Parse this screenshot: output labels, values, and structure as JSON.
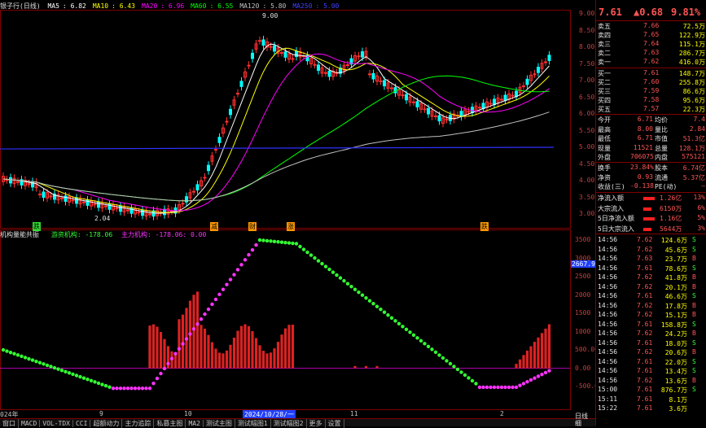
{
  "main": {
    "title": "银子行(日线)",
    "ma": [
      {
        "label": "MA5",
        "value": "6.82",
        "color": "#ffffff"
      },
      {
        "label": "MA10",
        "value": "6.43",
        "color": "#ffff00"
      },
      {
        "label": "MA20",
        "value": "6.96",
        "color": "#ff00ff"
      },
      {
        "label": "MA60",
        "value": "6.55",
        "color": "#00ff00"
      },
      {
        "label": "MA120",
        "value": "5.80",
        "color": "#c0c0c0"
      },
      {
        "label": "MA250",
        "value": "5.00",
        "color": "#4040ff"
      }
    ],
    "y_ticks": [
      "9.00",
      "8.50",
      "8.00",
      "7.50",
      "7.00",
      "6.50",
      "6.00",
      "5.50",
      "5.00",
      "4.50",
      "4.00",
      "3.50",
      "3.00"
    ],
    "high_label": "9.00",
    "low_label": "2.04",
    "markers": [
      "跌",
      "减",
      "财",
      "涨",
      "跌"
    ]
  },
  "sub": {
    "title": "机构量能共振",
    "item1": "游资机构: -178.06",
    "item2": "主力机构: -178.06: 0.00",
    "y_ticks": [
      "3500",
      "3000",
      "2500",
      "2000",
      "1500",
      "1000",
      "500.00",
      "0.00",
      "-500.00"
    ],
    "current_tag": "2667.95"
  },
  "dates": {
    "d1": "024年",
    "d2": "9",
    "d3": "10",
    "d4": "2024/10/28/一",
    "d5": "11",
    "d6": "12",
    "d7": "2"
  },
  "tabs": [
    "窗口",
    "MACD",
    "VOL-TDX",
    "CCI",
    "超额动力",
    "主力追踪",
    "私募主图",
    "MA2",
    "测试主图",
    "测试幅图1",
    "测试幅图2",
    "更多",
    "设置"
  ],
  "quote": {
    "price": "7.61",
    "change": "▲0.68",
    "pct": "9.81%",
    "asks": [
      {
        "label": "卖五",
        "price": "7.66",
        "vol": "72.5万"
      },
      {
        "label": "卖四",
        "price": "7.65",
        "vol": "122.9万"
      },
      {
        "label": "卖三",
        "price": "7.64",
        "vol": "115.1万"
      },
      {
        "label": "卖二",
        "price": "7.63",
        "vol": "286.7万"
      },
      {
        "label": "卖一",
        "price": "7.62",
        "vol": "416.0万"
      }
    ],
    "bids": [
      {
        "label": "买一",
        "price": "7.61",
        "vol": "148.7万"
      },
      {
        "label": "买二",
        "price": "7.60",
        "vol": "255.8万"
      },
      {
        "label": "买三",
        "price": "7.59",
        "vol": "86.6万"
      },
      {
        "label": "买四",
        "price": "7.58",
        "vol": "95.6万"
      },
      {
        "label": "买五",
        "price": "7.57",
        "vol": "22.3万"
      }
    ],
    "stats": [
      {
        "l1": "今开",
        "v1": "6.71",
        "l2": "均价",
        "v2": "7.4"
      },
      {
        "l1": "最高",
        "v1": "8.00",
        "l2": "量比",
        "v2": "2.84"
      },
      {
        "l1": "最低",
        "v1": "6.71",
        "l2": "市值",
        "v2": "51.3亿"
      },
      {
        "l1": "现量",
        "v1": "11521",
        "l2": "总量",
        "v2": "128.1万"
      },
      {
        "l1": "外盘",
        "v1": "706075",
        "l2": "内盘",
        "v2": "575121"
      }
    ],
    "stats2": [
      {
        "l1": "换手",
        "v1": "23.84%",
        "l2": "股本",
        "v2": "6.74亿"
      },
      {
        "l1": "净资",
        "v1": "0.93",
        "l2": "流通",
        "v2": "5.37亿"
      },
      {
        "l1": "收益(三)",
        "v1": "-0.138",
        "l2": "PE(动)",
        "v2": "—"
      }
    ],
    "flows": [
      {
        "label": "净流入额",
        "value": "1.26亿",
        "pct": "13%"
      },
      {
        "label": "大宗流入",
        "value": "6150万",
        "pct": "6%"
      },
      {
        "label": "5日净流入额",
        "value": "1.16亿",
        "pct": "5%"
      },
      {
        "label": "5日大宗流入",
        "value": "5644万",
        "pct": "3%"
      }
    ],
    "ticks": [
      {
        "t": "14:56",
        "p": "7.62",
        "v": "124.6万",
        "s": "S"
      },
      {
        "t": "14:56",
        "p": "7.62",
        "v": "45.6万",
        "s": "S"
      },
      {
        "t": "14:56",
        "p": "7.63",
        "v": "23.7万",
        "s": "B"
      },
      {
        "t": "14:56",
        "p": "7.61",
        "v": "78.6万",
        "s": "S"
      },
      {
        "t": "14:56",
        "p": "7.62",
        "v": "41.8万",
        "s": "B"
      },
      {
        "t": "14:56",
        "p": "7.62",
        "v": "20.1万",
        "s": "B"
      },
      {
        "t": "14:56",
        "p": "7.61",
        "v": "46.6万",
        "s": "S"
      },
      {
        "t": "14:56",
        "p": "7.62",
        "v": "17.8万",
        "s": "B"
      },
      {
        "t": "14:56",
        "p": "7.62",
        "v": "15.1万",
        "s": "B"
      },
      {
        "t": "14:56",
        "p": "7.61",
        "v": "158.8万",
        "s": "S"
      },
      {
        "t": "14:56",
        "p": "7.62",
        "v": "24.2万",
        "s": "B"
      },
      {
        "t": "14:56",
        "p": "7.61",
        "v": "18.0万",
        "s": "S"
      },
      {
        "t": "14:56",
        "p": "7.62",
        "v": "20.6万",
        "s": "B"
      },
      {
        "t": "14:56",
        "p": "7.61",
        "v": "22.0万",
        "s": "S"
      },
      {
        "t": "14:56",
        "p": "7.61",
        "v": "13.4万",
        "s": "S"
      },
      {
        "t": "14:56",
        "p": "7.62",
        "v": "13.6万",
        "s": "B"
      },
      {
        "t": "15:00",
        "p": "7.61",
        "v": "876.7万",
        "s": "S"
      },
      {
        "t": "15:11",
        "p": "7.61",
        "v": "8.1万",
        "s": ""
      },
      {
        "t": "15:22",
        "p": "7.61",
        "v": "3.6万",
        "s": ""
      }
    ],
    "footer_left": "日线",
    "footer_right": "细"
  },
  "colors": {
    "up": "#ff3030",
    "down": "#00ffff",
    "bar": "#dd2222",
    "green_dot": "#33ff33",
    "magenta_dot": "#ff33ff",
    "frame": "#800000"
  }
}
